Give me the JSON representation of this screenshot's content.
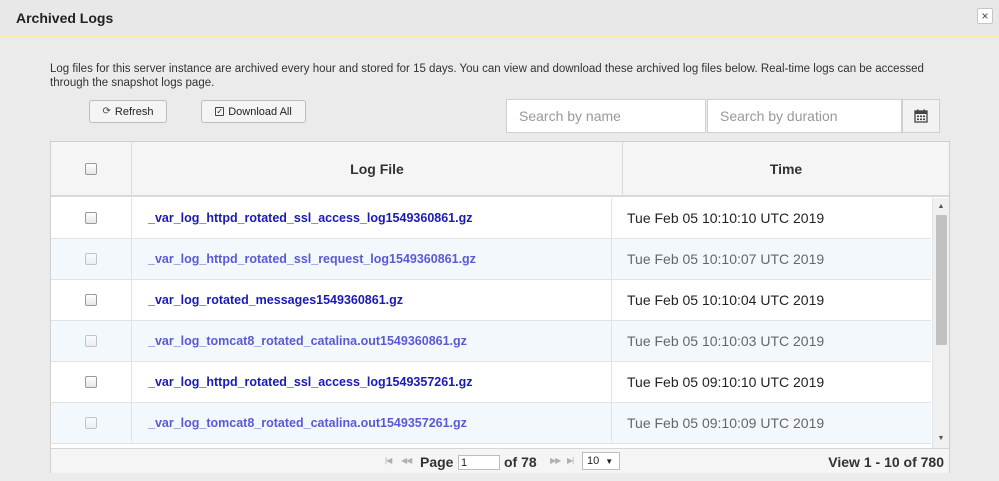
{
  "window": {
    "title": "Archived Logs",
    "close_symbol": "×"
  },
  "description": "Log files for this server instance are archived every hour and stored for 15 days. You can view and download these archived log files below. Real-time logs can be accessed through the snapshot logs page.",
  "toolbar": {
    "refresh_label": "Refresh",
    "refresh_icon": "refresh-icon",
    "download_all_label": "Download All",
    "download_all_icon": "checkbox-icon"
  },
  "search": {
    "name_placeholder": "Search by name",
    "name_value": "",
    "duration_placeholder": "Search by duration",
    "duration_value": "",
    "calendar_icon": "calendar-icon"
  },
  "table": {
    "columns": [
      "",
      "Log File",
      "Time"
    ],
    "rows": [
      {
        "file": "_var_log_httpd_rotated_ssl_access_log1549360861.gz",
        "time": "Tue Feb 05 10:10:10 UTC 2019"
      },
      {
        "file": "_var_log_httpd_rotated_ssl_request_log1549360861.gz",
        "time": "Tue Feb 05 10:10:07 UTC 2019"
      },
      {
        "file": "_var_log_rotated_messages1549360861.gz",
        "time": "Tue Feb 05 10:10:04 UTC 2019"
      },
      {
        "file": "_var_log_tomcat8_rotated_catalina.out1549360861.gz",
        "time": "Tue Feb 05 10:10:03 UTC 2019"
      },
      {
        "file": "_var_log_httpd_rotated_ssl_access_log1549357261.gz",
        "time": "Tue Feb 05 09:10:10 UTC 2019"
      },
      {
        "file": "_var_log_tomcat8_rotated_catalina.out1549357261.gz",
        "time": "Tue Feb 05 09:10:09 UTC 2019"
      }
    ]
  },
  "pager": {
    "page_label": "Page",
    "page_value": "1",
    "of_label": "of 78",
    "page_size": "10",
    "view_text": "View 1 - 10 of 780"
  }
}
